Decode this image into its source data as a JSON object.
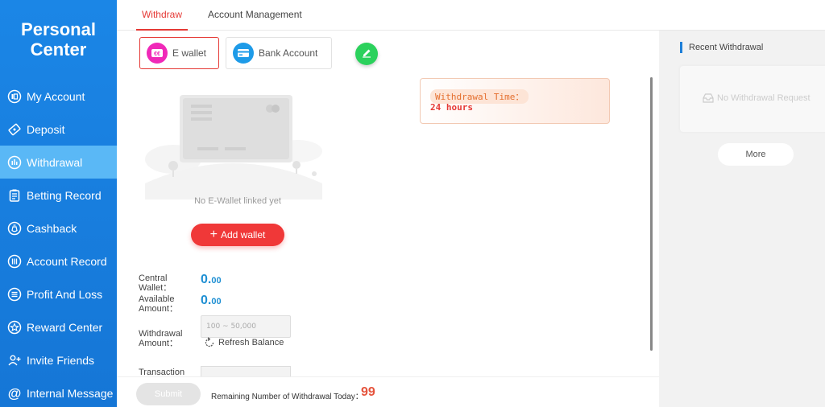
{
  "sidebar": {
    "title_line1": "Personal",
    "title_line2": "Center",
    "items": [
      {
        "label": "My Account",
        "icon": "account-icon"
      },
      {
        "label": "Deposit",
        "icon": "deposit-icon"
      },
      {
        "label": "Withdrawal",
        "icon": "withdrawal-icon",
        "active": true
      },
      {
        "label": "Betting Record",
        "icon": "betting-record-icon"
      },
      {
        "label": "Cashback",
        "icon": "cashback-icon"
      },
      {
        "label": "Account Record",
        "icon": "account-record-icon"
      },
      {
        "label": "Profit And Loss",
        "icon": "profit-loss-icon"
      },
      {
        "label": "Reward Center",
        "icon": "reward-icon"
      },
      {
        "label": "Invite Friends",
        "icon": "invite-icon"
      },
      {
        "label": "Internal Message",
        "icon": "message-icon"
      }
    ]
  },
  "tabs": [
    {
      "label": "Withdraw",
      "active": true
    },
    {
      "label": "Account Management"
    }
  ],
  "methods": {
    "ewallet": "E wallet",
    "bank": "Bank Account"
  },
  "withdrawal_time": {
    "label": "Withdrawal Time：",
    "value": "24 hours"
  },
  "empty_wallet": "No E-Wallet linked yet",
  "add_wallet": "Add wallet",
  "form": {
    "central_wallet_label_1": "Central",
    "central_wallet_label_2": "Wallet：",
    "central_wallet_int": "0.",
    "central_wallet_dec": "00",
    "available_label_1": "Available",
    "available_label_2": "Amount：",
    "available_int": "0.",
    "available_dec": "00",
    "withdrawal_label_1": "Withdrawal",
    "withdrawal_label_2": "Amount：",
    "withdrawal_placeholder": "100 ~ 50,000",
    "refresh": "Refresh Balance",
    "transaction_label": "Transaction"
  },
  "bottom": {
    "submit": "Submit",
    "remaining_label": "Remaining Number of Withdrawal Today：",
    "remaining_value": "99"
  },
  "recent": {
    "title": "Recent Withdrawal",
    "empty": "No Withdrawal Request",
    "more": "More"
  },
  "colors": {
    "sidebar": "#1b86e6",
    "sidebar_active": "#5ab8f6",
    "accent_red": "#e53935",
    "amount_blue": "#1e8fd3",
    "edit_green": "#2bd15c"
  }
}
